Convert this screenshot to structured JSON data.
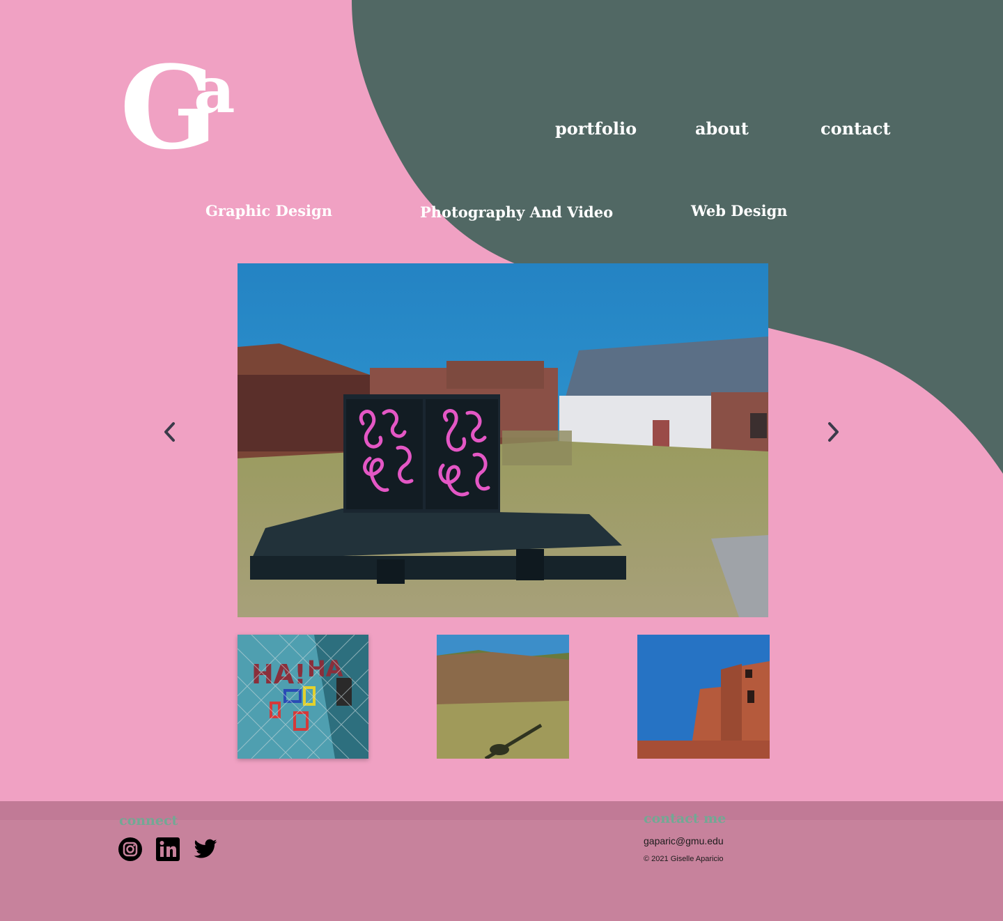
{
  "logo": {
    "letter_main": "G",
    "letter_super": "a"
  },
  "nav": {
    "portfolio": "portfolio",
    "about": "about",
    "contact": "contact"
  },
  "categories": {
    "graphic": "Graphic Design",
    "photo": "Photography And Video",
    "web": "Web Design"
  },
  "carousel": {
    "prev_icon": "chevron-left-icon",
    "next_icon": "chevron-right-icon",
    "hero_image": "photo of a black box with pink spray-painted swirls on a wooden pallet in a grassy lot in front of brick and white buildings under a blue sky",
    "thumbnails": [
      "chain-link fence with graffiti and colored frames on a brick wall",
      "grassy hill with a shadow of a person in the foreground",
      "red brick building against a blue sky"
    ]
  },
  "footer": {
    "connect_heading": "connect",
    "social_icons": [
      "instagram-icon",
      "linkedin-icon",
      "twitter-icon"
    ],
    "contact_heading": "contact me",
    "email": "gaparic@gmu.edu",
    "copyright": "© 2021 Giselle Aparicio"
  },
  "colors": {
    "pink": "#f0a1c3",
    "slate": "#516864",
    "footer": "#c7829c",
    "accent_green": "#72a894"
  }
}
